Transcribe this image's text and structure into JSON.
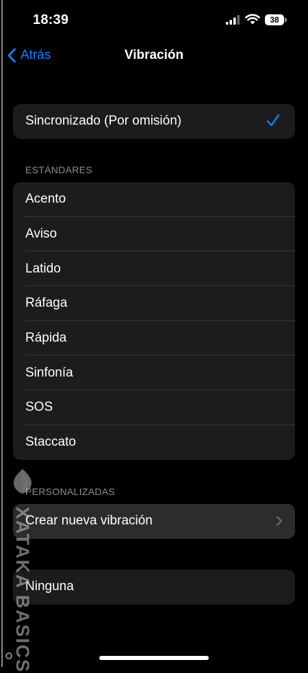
{
  "status_bar": {
    "time": "18:39",
    "battery": "38"
  },
  "nav": {
    "back_label": "Atrás",
    "title": "Vibración"
  },
  "selected_group": {
    "item": "Sincronizado (Por omisión)"
  },
  "standard_section": {
    "header": "ESTÁNDARES",
    "items": [
      "Acento",
      "Aviso",
      "Latido",
      "Ráfaga",
      "Rápida",
      "Sinfonía",
      "SOS",
      "Staccato"
    ]
  },
  "custom_section": {
    "header": "PERSONALIZADAS",
    "create_label": "Crear nueva vibración"
  },
  "none_group": {
    "label": "Ninguna"
  },
  "watermark": {
    "text": "XATAKA BASICS"
  },
  "colors": {
    "accent": "#0a84ff",
    "cell": "#1c1c1e",
    "separator": "#38383a",
    "secondary_text": "#8e8e93"
  }
}
